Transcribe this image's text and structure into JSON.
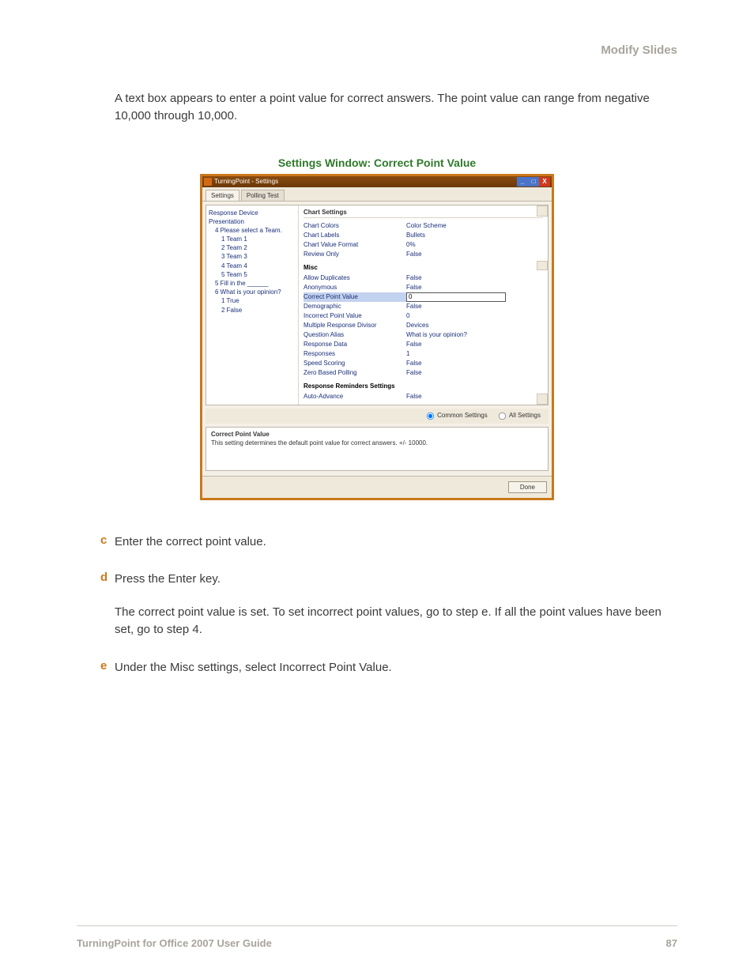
{
  "header": {
    "section": "Modify Slides"
  },
  "intro": "A text box appears to enter a point value for correct answers. The point value can range from negative 10,000 through 10,000.",
  "caption": "Settings Window: Correct Point Value",
  "window": {
    "title": "TurningPoint - Settings",
    "tabs": {
      "active": "Settings",
      "inactive": "Polling Test"
    },
    "tree": {
      "n0": "Response Device",
      "n1": "Presentation",
      "n2": "4  Please select a Team.",
      "n2_1": "1  Team 1",
      "n2_2": "2  Team 2",
      "n2_3": "3  Team 3",
      "n2_4": "4  Team 4",
      "n2_5": "5  Team 5",
      "n3": "5  Fill in the ______",
      "n4": "6  What is your opinion?",
      "n4_1": "1  True",
      "n4_2": "2  False"
    },
    "panel": {
      "header": "Chart Settings",
      "chart_colors_k": "Chart Colors",
      "chart_colors_v": "Color Scheme",
      "chart_labels_k": "Chart Labels",
      "chart_labels_v": "Bullets",
      "chart_value_format_k": "Chart Value Format",
      "chart_value_format_v": "0%",
      "review_only_k": "Review Only",
      "review_only_v": "False",
      "misc_header": "Misc",
      "allow_dup_k": "Allow Duplicates",
      "allow_dup_v": "False",
      "anonymous_k": "Anonymous",
      "anonymous_v": "False",
      "cpv_k": "Correct Point Value",
      "cpv_v": "0",
      "demographic_k": "Demographic",
      "demographic_v": "False",
      "ipv_k": "Incorrect Point Value",
      "ipv_v": "0",
      "mrd_k": "Multiple Response Divisor",
      "mrd_v": "Devices",
      "qalias_k": "Question Alias",
      "qalias_v": "What is your opinion?",
      "rdata_k": "Response Data",
      "rdata_v": "False",
      "responses_k": "Responses",
      "responses_v": "1",
      "speed_k": "Speed Scoring",
      "speed_v": "False",
      "zbp_k": "Zero Based Polling",
      "zbp_v": "False",
      "rrs_header": "Response Reminders Settings",
      "auto_adv_k": "Auto-Advance",
      "auto_adv_v": "False"
    },
    "radios": {
      "common": "Common Settings",
      "all": "All Settings"
    },
    "desc": {
      "title": "Correct Point Value",
      "text": "This setting determines the default point value for correct answers. +/- 10000."
    },
    "done": "Done"
  },
  "steps": {
    "c": {
      "marker": "c",
      "text": "Enter the correct point value."
    },
    "d": {
      "marker": "d",
      "text": "Press the Enter key.",
      "follow": "The correct point value is set. To set incorrect point values, go to step e. If all the point values have been set, go to step 4."
    },
    "e": {
      "marker": "e",
      "text": "Under the Misc settings, select Incorrect Point Value."
    }
  },
  "footer": {
    "left": "TurningPoint for Office 2007 User Guide",
    "right": "87"
  }
}
